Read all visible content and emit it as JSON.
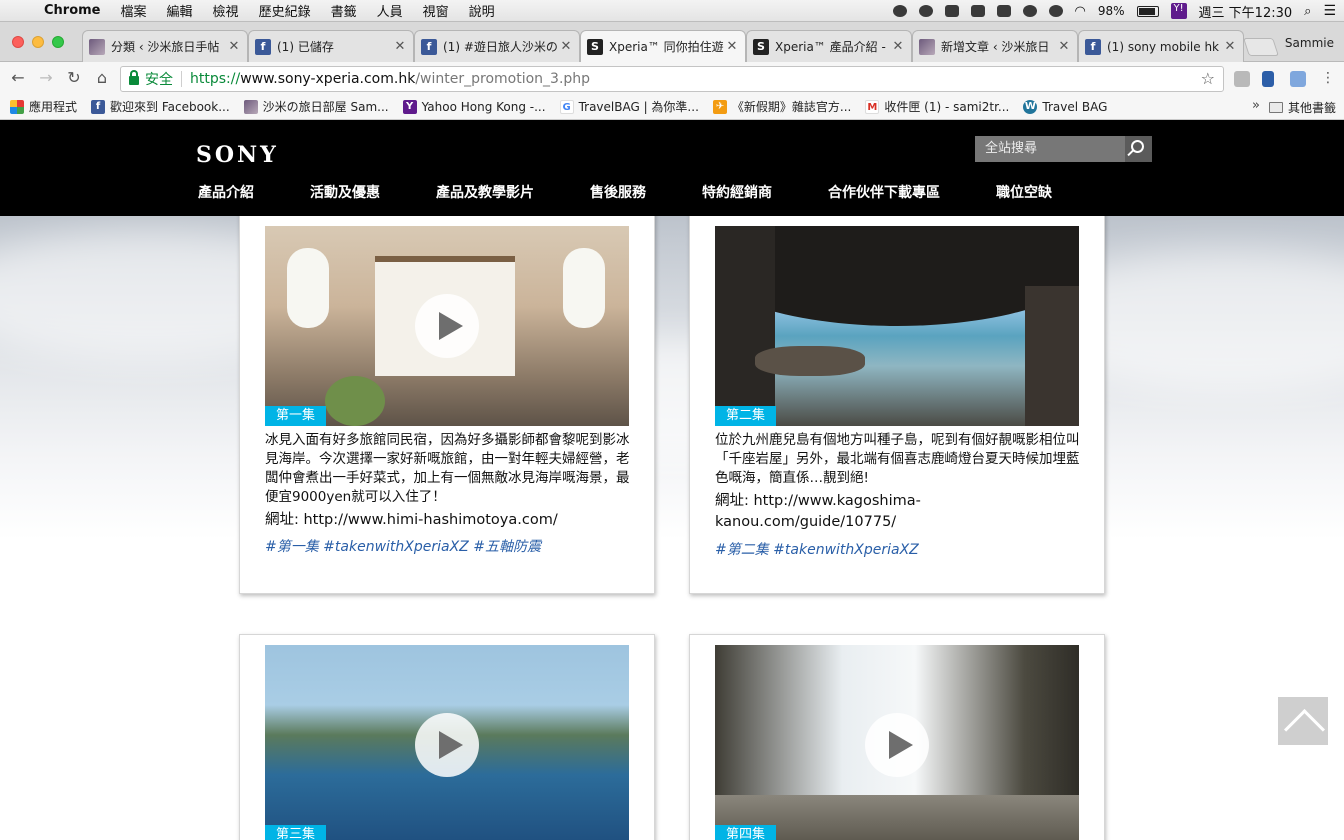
{
  "os_menu": {
    "app_name": "Chrome",
    "items": [
      "檔案",
      "編輯",
      "檢視",
      "歷史紀錄",
      "書籤",
      "人員",
      "視窗",
      "說明"
    ],
    "battery": "98%",
    "clock": "週三 下午12:30"
  },
  "browser": {
    "tabs": [
      {
        "title": "分類 ‹ 沙米旅日手帖",
        "favicon": "photo-favicon",
        "active": false
      },
      {
        "title": "(1) 已儲存",
        "favicon": "facebook-favicon",
        "active": false
      },
      {
        "title": "(1) #遊日旅人沙米の",
        "favicon": "facebook-favicon",
        "active": false
      },
      {
        "title": "Xperia™ 同你拍住遊",
        "favicon": "sony-favicon",
        "active": true
      },
      {
        "title": "Xperia™ 產品介紹 -",
        "favicon": "sony-favicon",
        "active": false
      },
      {
        "title": "新增文章 ‹ 沙米旅日",
        "favicon": "photo-favicon",
        "active": false
      },
      {
        "title": "(1) sony mobile hk -",
        "favicon": "facebook-favicon",
        "active": false
      }
    ],
    "profile_name": "Sammie",
    "address_bar": {
      "secure_label": "安全",
      "url_scheme": "https://",
      "url_host": "www.sony-xperia.com.hk",
      "url_path": "/winter_promotion_3.php"
    },
    "bookmarks": [
      {
        "label": "應用程式",
        "icon": "apps-icon"
      },
      {
        "label": "歡迎來到 Facebook...",
        "icon": "facebook-icon"
      },
      {
        "label": "沙米の旅日部屋 Sam...",
        "icon": "photo-icon"
      },
      {
        "label": "Yahoo Hong Kong -...",
        "icon": "yahoo-icon"
      },
      {
        "label": "TravelBAG | 為你準...",
        "icon": "google-icon"
      },
      {
        "label": "《新假期》雜誌官方...",
        "icon": "plane-icon"
      },
      {
        "label": "收件匣 (1) - sami2tr...",
        "icon": "gmail-icon"
      },
      {
        "label": "Travel BAG",
        "icon": "wordpress-icon"
      }
    ],
    "bookmarks_more": "»",
    "other_bookmarks": "其他書籤"
  },
  "site": {
    "logo": "SONY",
    "search_placeholder": "全站搜尋",
    "nav": [
      "產品介紹",
      "活動及優惠",
      "產品及教學影片",
      "售後服務",
      "特約經銷商",
      "合作伙伴下載專區",
      "職位空缺"
    ]
  },
  "cards": [
    {
      "episode": "第一集",
      "text": "冰見入面有好多旅館同民宿，因為好多攝影師都會黎呢到影冰見海岸。今次選擇一家好新嘅旅館，由一對年輕夫婦經營，老闆仲會煮出一手好菜式，加上有一個無敵冰見海岸嘅海景，最便宜9000yen就可以入住了！",
      "link": "網址: http://www.himi-hashimotoya.com/",
      "hashtags": "#第一集 #takenwithXperiaXZ #五軸防震"
    },
    {
      "episode": "第二集",
      "text": "位於九州鹿兒島有個地方叫種子島，呢到有個好靚嘅影相位叫「千座岩屋」另外，最北端有個喜志鹿崎燈台夏天時候加埋藍色嘅海，簡直係…靚到絕!",
      "link": "網址: http://www.kagoshima-kanou.com/guide/10775/",
      "hashtags": "#第二集 #takenwithXperiaXZ"
    },
    {
      "episode": "第三集"
    },
    {
      "episode": "第四集"
    }
  ],
  "colors": {
    "episode_badge": "#00b4e6",
    "hashtag": "#2a5fa8",
    "header_bg": "#000000",
    "secure_green": "#0a8a3a"
  }
}
